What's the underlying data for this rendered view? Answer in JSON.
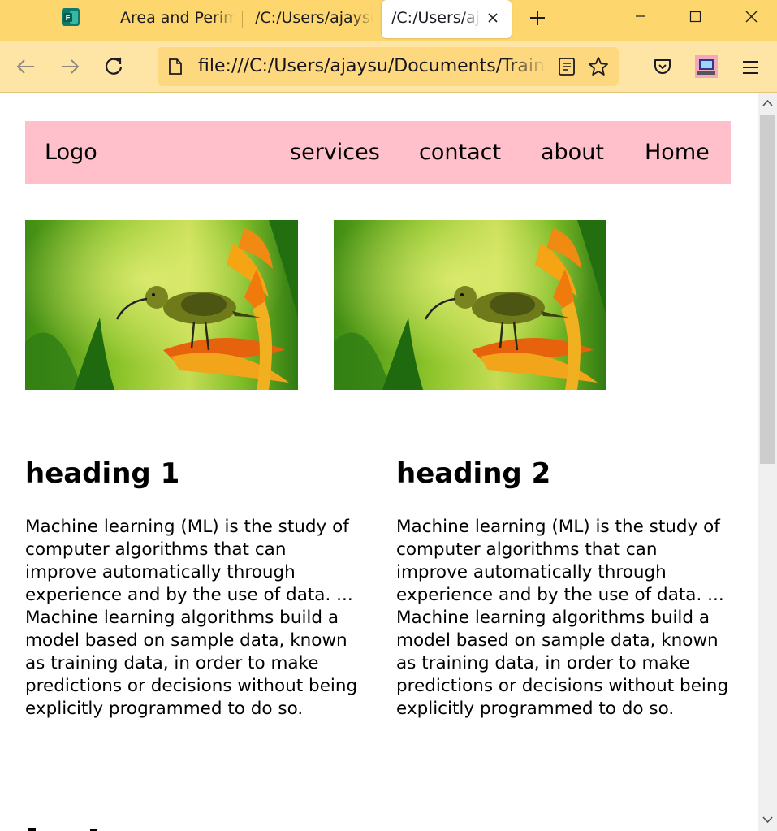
{
  "browser": {
    "tabs": [
      {
        "label": "Area and Perimeter"
      },
      {
        "label": "/C:/Users/ajaysu"
      },
      {
        "label": "/C:/Users/ajaysu",
        "active": true
      }
    ],
    "url": "file:///C:/Users/ajaysu/Documents/Training",
    "colors": {
      "tab_strip": "#fdd66e",
      "toolbar": "#fee5a5",
      "url_field": "#fed87f"
    },
    "icons": [
      "forms-app-icon",
      "close-tab-icon",
      "new-tab-icon",
      "minimize-icon",
      "maximize-icon",
      "close-window-icon",
      "back-icon",
      "forward-icon",
      "reload-icon",
      "page-icon",
      "reader-view-icon",
      "bookmark-star-icon",
      "pocket-icon",
      "profile-icon",
      "menu-icon"
    ]
  },
  "page": {
    "nav": {
      "logo": "Logo",
      "links": [
        "services",
        "contact",
        "about",
        "Home"
      ],
      "background": "#ffc0cb"
    },
    "images": [
      {
        "subject": "sunbird perched on heliconia flower"
      },
      {
        "subject": "sunbird perched on heliconia flower"
      }
    ],
    "sections": [
      {
        "heading": "heading 1",
        "text": "Machine learning (ML) is the study of computer algorithms that can improve automatically through experience and by the use of data. ... Machine learning algorithms build a model based on sample data, known as training data, in order to make predictions or decisions without being explicitly programmed to do so."
      },
      {
        "heading": "heading 2",
        "text": "Machine learning (ML) is the study of computer algorithms that can improve automatically through experience and by the use of data. ... Machine learning algorithms build a model based on sample data, known as training data, in order to make predictions or decisions without being explicitly programmed to do so."
      }
    ]
  }
}
